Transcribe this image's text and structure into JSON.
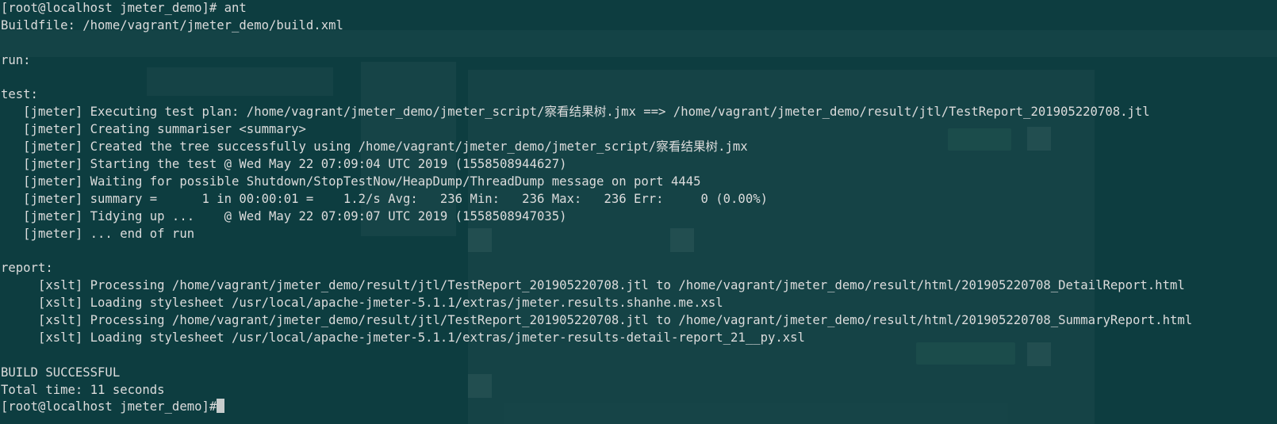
{
  "terminal": {
    "prompt": "[root@localhost jmeter_demo]#",
    "lines": [
      "[root@localhost jmeter_demo]# ant",
      "Buildfile: /home/vagrant/jmeter_demo/build.xml",
      "",
      "run:",
      "",
      "test:",
      "   [jmeter] Executing test plan: /home/vagrant/jmeter_demo/jmeter_script/察看结果树.jmx ==> /home/vagrant/jmeter_demo/result/jtl/TestReport_201905220708.jtl",
      "   [jmeter] Creating summariser <summary>",
      "   [jmeter] Created the tree successfully using /home/vagrant/jmeter_demo/jmeter_script/察看结果树.jmx",
      "   [jmeter] Starting the test @ Wed May 22 07:09:04 UTC 2019 (1558508944627)",
      "   [jmeter] Waiting for possible Shutdown/StopTestNow/HeapDump/ThreadDump message on port 4445",
      "   [jmeter] summary =      1 in 00:00:01 =    1.2/s Avg:   236 Min:   236 Max:   236 Err:     0 (0.00%)",
      "   [jmeter] Tidying up ...    @ Wed May 22 07:09:07 UTC 2019 (1558508947035)",
      "   [jmeter] ... end of run",
      "",
      "report:",
      "     [xslt] Processing /home/vagrant/jmeter_demo/result/jtl/TestReport_201905220708.jtl to /home/vagrant/jmeter_demo/result/html/201905220708_DetailReport.html",
      "     [xslt] Loading stylesheet /usr/local/apache-jmeter-5.1.1/extras/jmeter.results.shanhe.me.xsl",
      "     [xslt] Processing /home/vagrant/jmeter_demo/result/jtl/TestReport_201905220708.jtl to /home/vagrant/jmeter_demo/result/html/201905220708_SummaryReport.html",
      "     [xslt] Loading stylesheet /usr/local/apache-jmeter-5.1.1/extras/jmeter-results-detail-report_21__py.xsl",
      "",
      "BUILD SUCCESSFUL",
      "Total time: 11 seconds"
    ]
  },
  "colors": {
    "background": "#0d3d40",
    "text": "#dcdcdc"
  }
}
